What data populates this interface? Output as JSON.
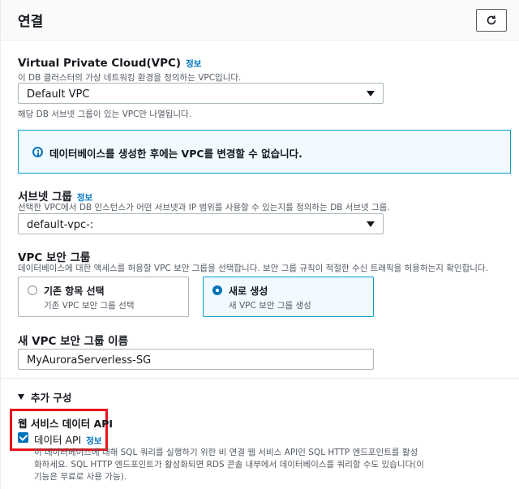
{
  "header": {
    "title": "연결"
  },
  "vpc": {
    "label": "Virtual Private Cloud(VPC)",
    "info": "정보",
    "description": "이 DB 클러스터의 가상 네트워킹 환경을 정의하는 VPC입니다.",
    "selected": "Default VPC",
    "hint": "해당 DB 서브넷 그룹이 있는 VPC만 나열됩니다."
  },
  "alert": {
    "text": "데이터베이스를 생성한 후에는 VPC를 변경할 수 없습니다."
  },
  "subnet": {
    "label": "서브넷 그룹",
    "info": "정보",
    "description": "선택한 VPC에서 DB 인스턴스가 어떤 서브넷과 IP 범위를 사용할 수 있는지를 정의하는 DB 서브넷 그룹.",
    "selected": "default-vpc-:"
  },
  "security_group": {
    "label": "VPC 보안 그룹",
    "description": "데이터베이스에 대한 액세스를 허용할 VPC 보안 그룹을 선택합니다. 보안 그룹 규칙이 적절한 수신 트래픽을 허용하는지 확인합니다.",
    "options": [
      {
        "title": "기존 항목 선택",
        "desc": "기존 VPC 보안 그룹 선택",
        "selected": false
      },
      {
        "title": "새로 생성",
        "desc": "새 VPC 보안 그룹 생성",
        "selected": true
      }
    ]
  },
  "new_sg": {
    "label": "새 VPC 보안 그룹 이름",
    "value": "MyAuroraServerless-SG"
  },
  "additional": {
    "label": "추가 구성"
  },
  "data_api": {
    "heading": "웹 서비스 데이터 API",
    "checkbox_label": "데이터 API",
    "info": "정보",
    "checked": true,
    "description_lines": [
      "이 데이터베이스에 대해 SQL 쿼리를 실행하기 위한 비 연결 웹 서비스 API인 SQL HTTP 엔드포인트를 활성",
      "화하세요. SQL HTTP 엔드포인트가 활성화되면 RDS 콘솔 내부에서 데이터베이스를 쿼리할 수도 있습니다(이",
      "기능은 무료로 사용 가능)."
    ]
  },
  "colors": {
    "accent": "#0073bb",
    "highlight": "#e8141a",
    "alert_bg": "#f1faff"
  }
}
